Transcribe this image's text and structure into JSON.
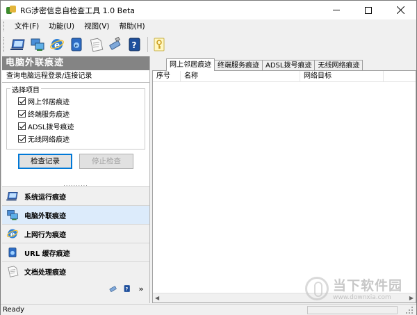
{
  "window": {
    "title": "RG涉密信息自检查工具 1.0 Beta",
    "controls": {
      "minimize": "─",
      "maximize": "□",
      "close": "✕"
    }
  },
  "menu": [
    "文件(F)",
    "功能(U)",
    "视图(V)",
    "帮助(H)"
  ],
  "toolbar": {
    "icons": [
      "system-run-icon",
      "network-computer-icon",
      "ie-browser-icon",
      "cache-icon",
      "document-icon",
      "usb-icon",
      "help-icon",
      "key-icon"
    ]
  },
  "left_panel": {
    "section_title": "电脑外联痕迹",
    "section_subtitle": "查询电脑远程登录/连接记录",
    "group_label": "选择项目",
    "options": [
      {
        "label": "网上邻居痕迹",
        "checked": true
      },
      {
        "label": "终端服务痕迹",
        "checked": true
      },
      {
        "label": "ADSL拨号痕迹",
        "checked": true
      },
      {
        "label": "无线网络痕迹",
        "checked": true
      }
    ],
    "check_button": "检查记录",
    "stop_button": "停止检查",
    "nav_items": [
      {
        "label": "系统运行痕迹",
        "icon": "system-run-icon",
        "active": false
      },
      {
        "label": "电脑外联痕迹",
        "icon": "network-computer-icon",
        "active": true
      },
      {
        "label": "上网行为痕迹",
        "icon": "ie-browser-icon",
        "active": false
      },
      {
        "label": "URL 缓存痕迹",
        "icon": "cache-icon",
        "active": false
      },
      {
        "label": "文档处理痕迹",
        "icon": "document-icon",
        "active": false
      }
    ]
  },
  "right_panel": {
    "tabs": [
      "网上邻居痕迹",
      "终端服务痕迹",
      "ADSL拨号痕迹",
      "无线网络痕迹"
    ],
    "active_tab": 0,
    "columns": [
      "序号",
      "名称",
      "网络目标"
    ]
  },
  "watermark": {
    "line1": "当下软件园",
    "line2": "www.downxia.com"
  },
  "status": {
    "text": "Ready"
  }
}
